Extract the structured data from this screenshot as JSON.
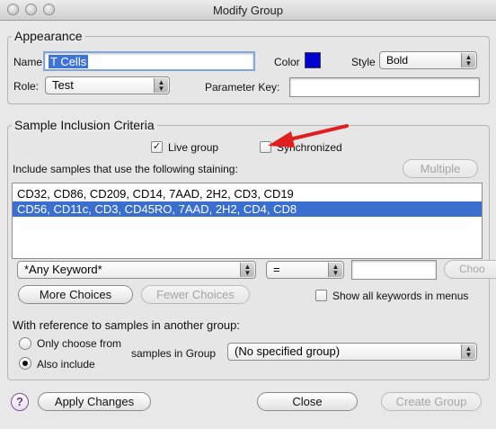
{
  "window": {
    "title": "Modify Group"
  },
  "appearance": {
    "legend": "Appearance",
    "name_label": "Name",
    "name_value": "T Cells",
    "color_label": "Color",
    "color_value": "#0000d0",
    "style_label": "Style",
    "style_value": "Bold",
    "role_label": "Role:",
    "role_value": "Test",
    "param_key_label": "Parameter Key:",
    "param_key_value": ""
  },
  "criteria": {
    "legend": "Sample Inclusion Criteria",
    "live_group_label": "Live group",
    "live_group_checked": true,
    "synchronized_label": "Synchronized",
    "synchronized_checked": false,
    "staining_label": "Include samples that use the following staining:",
    "multiple_label": "Multiple",
    "staining_items": [
      {
        "text": "CD32, CD86, CD209, CD14, 7AAD, 2H2, CD3, CD19",
        "selected": false
      },
      {
        "text": "CD56, CD11c, CD3, CD45RO, 7AAD, 2H2, CD4, CD8",
        "selected": true
      }
    ],
    "keyword_value": "*Any Keyword*",
    "operator_value": "=",
    "keyword_text_value": "",
    "choose_label": "Choo",
    "more_choices_label": "More Choices",
    "fewer_choices_label": "Fewer Choices",
    "show_all_label": "Show all keywords in menus",
    "show_all_checked": false,
    "reference_label": "With reference to samples in another group:",
    "only_choose_label": "Only choose from",
    "also_include_label": "Also include",
    "also_include_selected": true,
    "samples_in_group_label": "samples in Group",
    "group_value": "(No specified group)"
  },
  "footer": {
    "help_label": "?",
    "apply_label": "Apply Changes",
    "close_label": "Close",
    "create_label": "Create Group"
  },
  "colors": {
    "annotation_arrow": "#e02020",
    "selection": "#3a6fd0"
  }
}
